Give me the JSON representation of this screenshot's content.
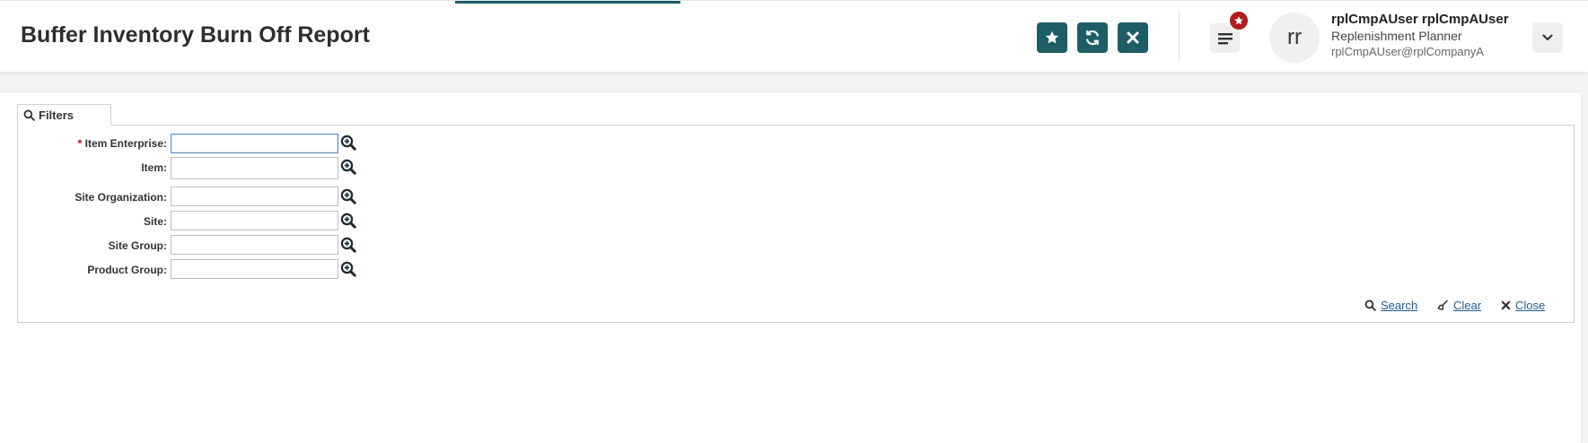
{
  "header": {
    "title": "Buffer Inventory Burn Off Report",
    "actions": {
      "favorite_icon": "star-icon",
      "refresh_icon": "refresh-icon",
      "close_icon": "close-icon"
    },
    "accent_color": "#1f5d66",
    "badge_color": "#b01c1c"
  },
  "user": {
    "initials": "rr",
    "name": "rplCmpAUser rplCmpAUser",
    "role": "Replenishment Planner",
    "email": "rplCmpAUser@rplCompanyA"
  },
  "filters": {
    "tab_label": "Filters",
    "fields": [
      {
        "label": "Item Enterprise:",
        "required": true,
        "value": ""
      },
      {
        "label": "Item:",
        "required": false,
        "value": ""
      },
      {
        "label": "Site Organization:",
        "required": false,
        "value": ""
      },
      {
        "label": "Site:",
        "required": false,
        "value": ""
      },
      {
        "label": "Site Group:",
        "required": false,
        "value": ""
      },
      {
        "label": "Product Group:",
        "required": false,
        "value": ""
      }
    ],
    "required_marker": "*",
    "actions": {
      "search": "Search",
      "clear": "Clear",
      "close": "Close"
    }
  }
}
